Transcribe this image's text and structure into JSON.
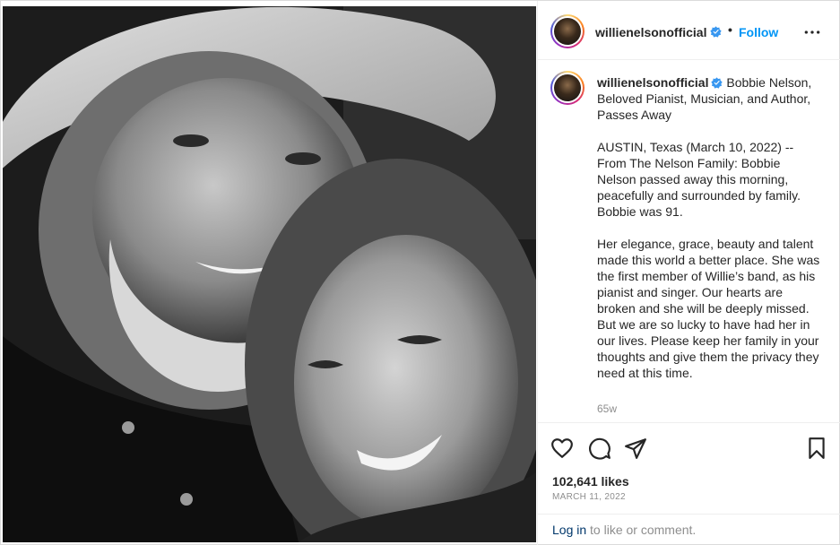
{
  "header": {
    "username": "willienelsonofficial",
    "separator": "•",
    "follow_label": "Follow",
    "more_icon": "more-horizontal-icon"
  },
  "caption": {
    "username": "willienelsonofficial",
    "headline": "Bobbie Nelson, Beloved Pianist, Musician, and Author, Passes Away",
    "paragraph_1": "AUSTIN, Texas (March 10, 2022) -- From The Nelson Family: Bobbie Nelson passed away this morning, peacefully and surrounded by family. Bobbie was 91.",
    "paragraph_2": "Her elegance, grace, beauty and talent made this world a better place. She was the first member of Willie’s band, as his pianist and singer. Our hearts are broken and she will be deeply missed. But we are so lucky to have had her in our lives. Please keep her family in your thoughts and give them the privacy they need at this time.",
    "age": "65w"
  },
  "actions": {
    "like_icon": "heart-icon",
    "comment_icon": "comment-icon",
    "share_icon": "share-icon",
    "save_icon": "bookmark-icon"
  },
  "likes": "102,641 likes",
  "date": "MARCH 11, 2022",
  "login": {
    "link_label": "Log in",
    "rest_text": " to like or comment."
  },
  "colors": {
    "accent": "#0095f6",
    "verified": "#3897f0",
    "muted": "#8e8e8e",
    "text": "#262626"
  }
}
